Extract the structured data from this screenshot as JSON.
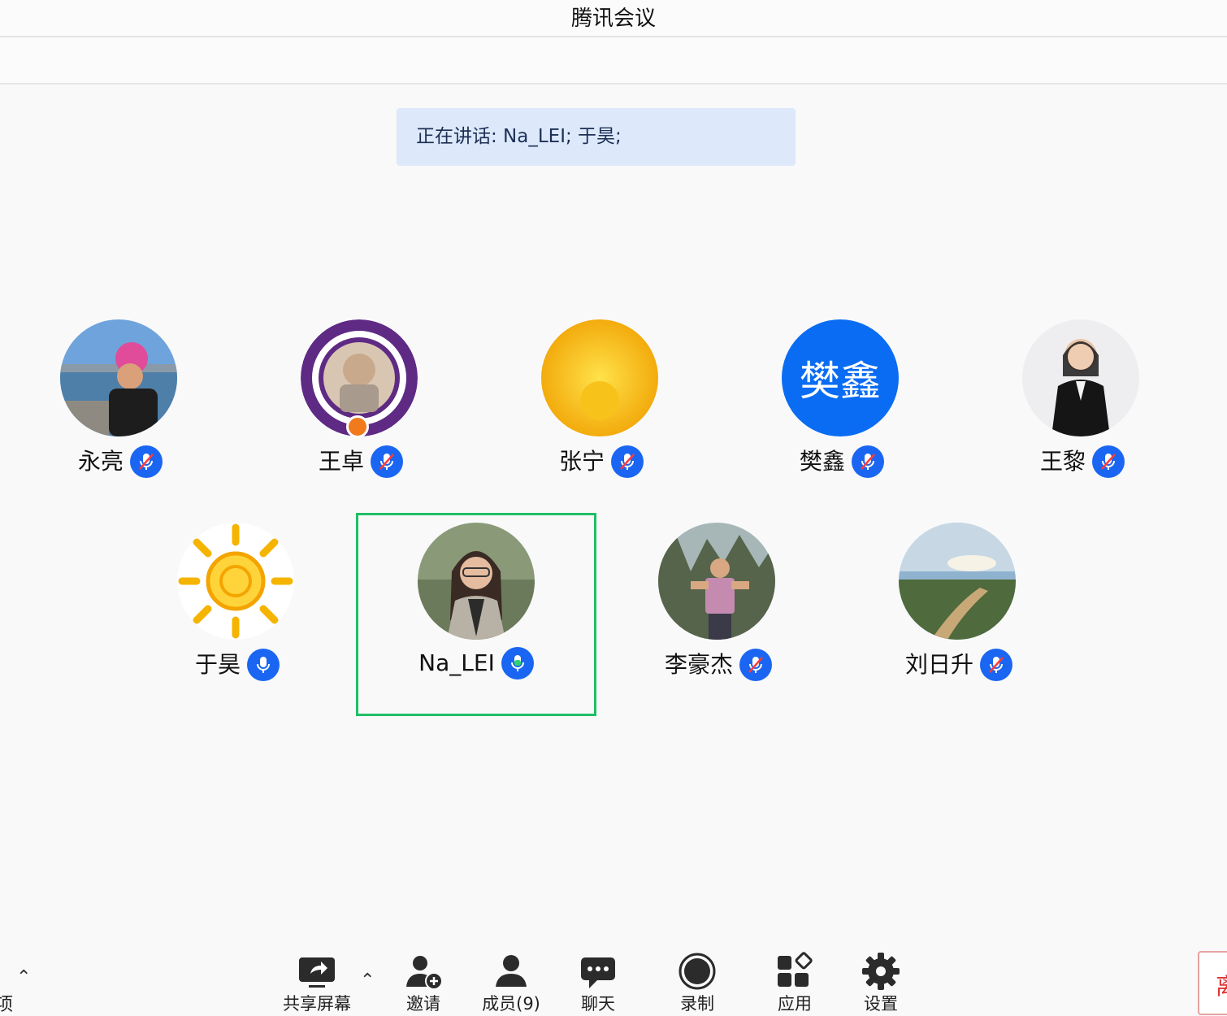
{
  "window": {
    "title": "腾讯会议"
  },
  "speaking_banner": "正在讲话: Na_LEI; 于昊;",
  "participants": [
    {
      "name": "永亮",
      "mic": "muted"
    },
    {
      "name": "王卓",
      "mic": "muted",
      "is_host": true
    },
    {
      "name": "张宁",
      "mic": "muted"
    },
    {
      "name": "樊鑫",
      "mic": "muted",
      "avatar_text": "樊鑫",
      "avatar_color": "#0a6cf2"
    },
    {
      "name": "王黎",
      "mic": "muted"
    },
    {
      "name": "于昊",
      "mic": "on"
    },
    {
      "name": "Na_LEI",
      "mic": "speaking",
      "active": true
    },
    {
      "name": "李豪杰",
      "mic": "muted"
    },
    {
      "name": "刘日升",
      "mic": "muted"
    }
  ],
  "toolbar": {
    "left_partial": "项",
    "share": "共享屏幕",
    "invite": "邀请",
    "members": "成员(9)",
    "chat": "聊天",
    "record": "录制",
    "apps": "应用",
    "settings": "设置",
    "leave_partial": "离"
  },
  "colors": {
    "accent": "#1a66f2",
    "active_border": "#1fbf66",
    "banner_bg": "#dde9fb"
  }
}
